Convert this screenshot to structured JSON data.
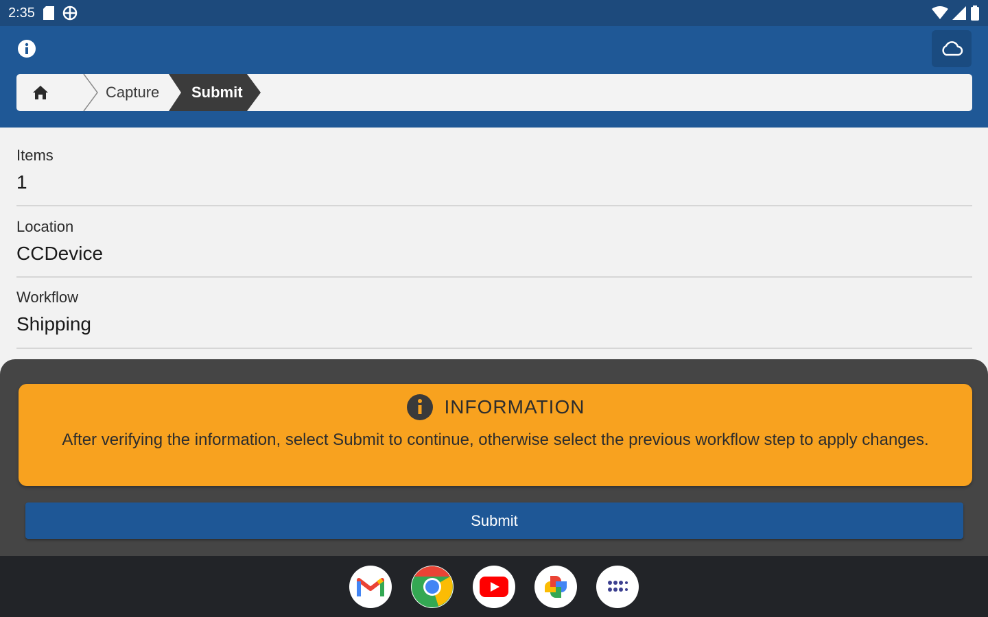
{
  "status_bar": {
    "time": "2:35"
  },
  "breadcrumb": {
    "items": [
      {
        "label": "Capture"
      },
      {
        "label": "Submit"
      }
    ]
  },
  "fields": [
    {
      "label": "Items",
      "value": "1"
    },
    {
      "label": "Location",
      "value": "CCDevice"
    },
    {
      "label": "Workflow",
      "value": "Shipping"
    }
  ],
  "info_card": {
    "title": "INFORMATION",
    "body": "After verifying the information, select Submit to continue, otherwise select the previous workflow step to apply changes."
  },
  "submit_button": {
    "label": "Submit"
  },
  "dock": {
    "apps": [
      "gmail-icon",
      "chrome-icon",
      "youtube-icon",
      "photos-icon",
      "app-drawer-icon"
    ]
  },
  "colors": {
    "app_bar": "#1f5896",
    "status_bar": "#1d4a7c",
    "info_card": "#f8a21f",
    "submit": "#1e5796",
    "sheet": "#454545"
  }
}
